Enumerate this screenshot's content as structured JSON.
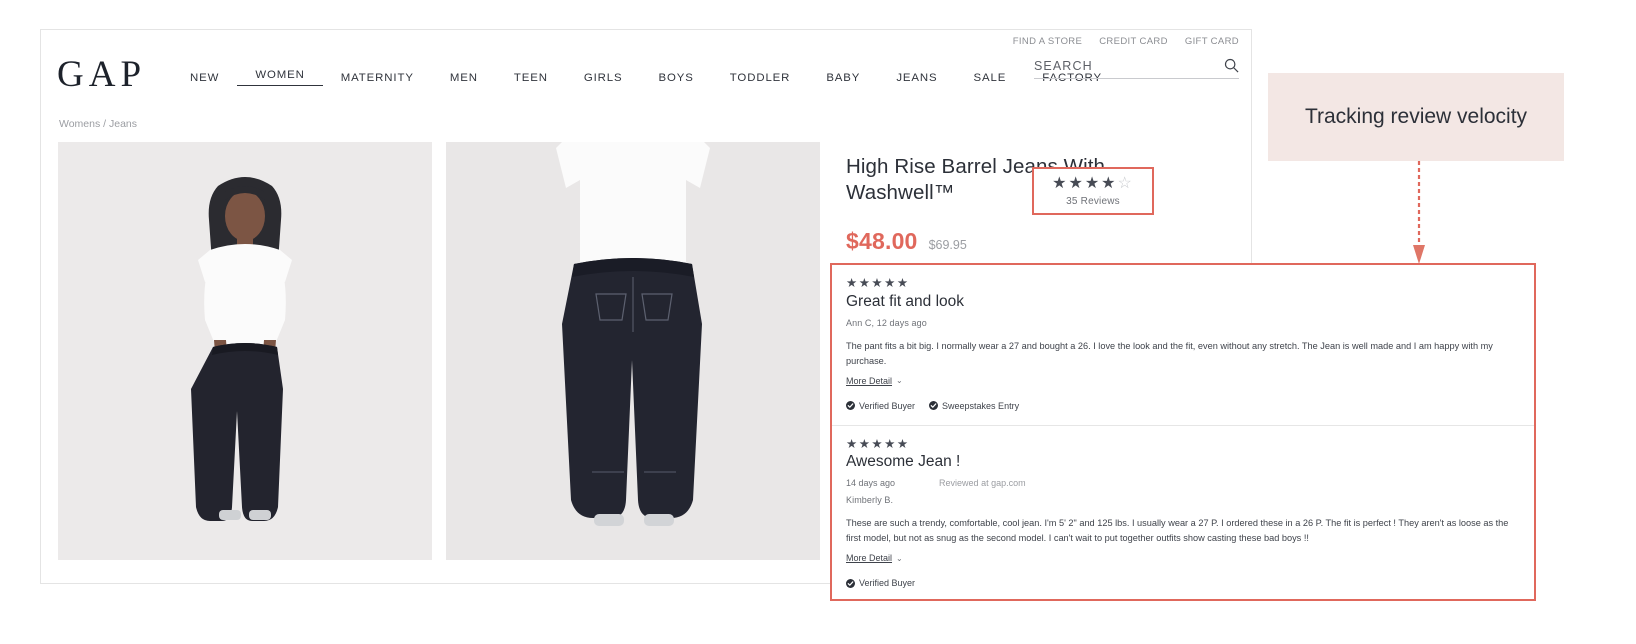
{
  "annotation": {
    "label": "Tracking review velocity",
    "accent_color": "#e0685c",
    "box_fill": "#f3e7e4",
    "arrow_icon": "down-arrow-icon"
  },
  "site": {
    "brand": "GAP",
    "utility_links": [
      {
        "label": "FIND A STORE"
      },
      {
        "label": "CREDIT CARD"
      },
      {
        "label": "GIFT CARD"
      }
    ],
    "search": {
      "placeholder": "SEARCH",
      "value": "",
      "icon": "search-icon"
    },
    "nav": [
      {
        "label": "NEW",
        "active": false
      },
      {
        "label": "WOMEN",
        "active": true
      },
      {
        "label": "MATERNITY",
        "active": false
      },
      {
        "label": "MEN",
        "active": false
      },
      {
        "label": "TEEN",
        "active": false
      },
      {
        "label": "GIRLS",
        "active": false
      },
      {
        "label": "BOYS",
        "active": false
      },
      {
        "label": "TODDLER",
        "active": false
      },
      {
        "label": "BABY",
        "active": false
      },
      {
        "label": "JEANS",
        "active": false
      },
      {
        "label": "SALE",
        "active": false
      },
      {
        "label": "FACTORY",
        "active": false
      }
    ],
    "breadcrumb": "Womens / Jeans"
  },
  "product": {
    "title": "High Rise Barrel Jeans With Washwell™",
    "sale_price": "$48.00",
    "original_price": "$69.95",
    "gallery": [
      {
        "alt": "model-front-view"
      },
      {
        "alt": "model-back-view"
      }
    ],
    "rating": {
      "stars_filled": 4,
      "stars_total": 5,
      "stars_glyph_filled": "★★★★",
      "stars_glyph_empty": "☆",
      "review_count_label": "35 Reviews"
    }
  },
  "reviews": [
    {
      "stars": "★★★★★",
      "title": "Great fit and look",
      "meta": "Ann C, 12 days ago",
      "body": "The pant fits a bit big. I normally wear a 27 and bought a 26. I love the look and the fit, even without any stretch. The Jean is well made and I am happy with my purchase.",
      "more_label": "More Detail",
      "more_chevron": "⌄",
      "badges": [
        {
          "label": "Verified Buyer",
          "icon": "check-circle-icon"
        },
        {
          "label": "Sweepstakes Entry",
          "icon": "check-circle-icon"
        }
      ]
    },
    {
      "stars": "★★★★★",
      "title": "Awesome Jean !",
      "date": "14 days ago",
      "source": "Reviewed at gap.com",
      "author": "Kimberly B.",
      "body": "These are such a trendy, comfortable, cool jean. I'm 5' 2\" and 125 lbs. I usually wear a 27 P. I ordered these in a 26 P. The fit is perfect ! They aren't as loose as the first model, but not as snug as the second model. I can't wait to put together outfits show casting these bad boys !!",
      "more_label": "More Detail",
      "more_chevron": "⌄",
      "badges": [
        {
          "label": "Verified Buyer",
          "icon": "check-circle-icon"
        }
      ]
    }
  ]
}
